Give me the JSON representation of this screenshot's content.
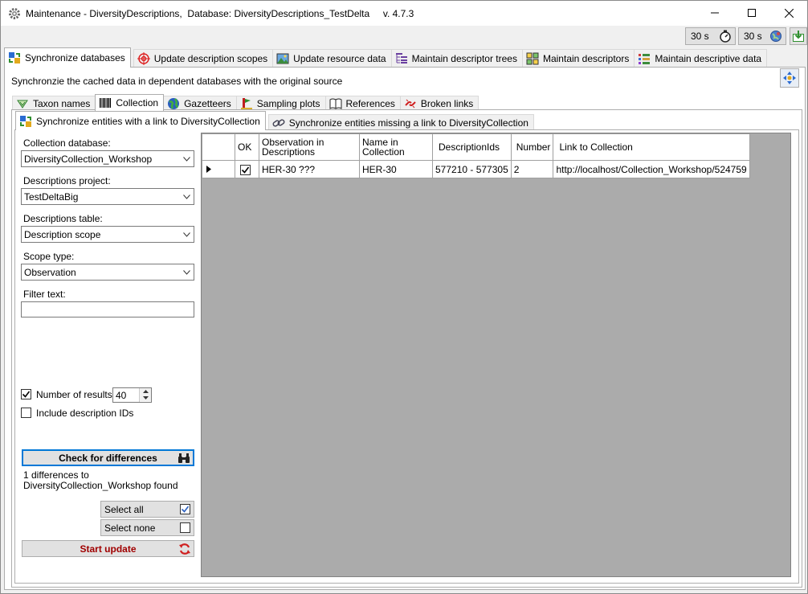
{
  "window": {
    "title": "Maintenance - DiversityDescriptions,  Database: DiversityDescriptions_TestDelta     v. 4.7.3"
  },
  "toolbar": {
    "timer1": "30 s",
    "timer2": "30 s"
  },
  "main_tabs": [
    {
      "label": "Synchronize databases",
      "icon": "sync-databases-icon",
      "active": true
    },
    {
      "label": "Update description scopes",
      "icon": "target-icon",
      "active": false
    },
    {
      "label": "Update resource data",
      "icon": "image-icon",
      "active": false
    },
    {
      "label": "Maintain descriptor trees",
      "icon": "tree-icon",
      "active": false
    },
    {
      "label": "Maintain descriptors",
      "icon": "descriptor-icon",
      "active": false
    },
    {
      "label": "Maintain descriptive data",
      "icon": "data-grid-icon",
      "active": false
    }
  ],
  "description": "Synchronzie the cached data in dependent databases with the original source",
  "sub_tabs": [
    {
      "label": "Taxon names",
      "icon": "taxon-icon",
      "active": false
    },
    {
      "label": "Collection",
      "icon": "barcode-icon",
      "active": true
    },
    {
      "label": "Gazetteers",
      "icon": "globe-icon",
      "active": false
    },
    {
      "label": "Sampling plots",
      "icon": "plot-icon",
      "active": false
    },
    {
      "label": "References",
      "icon": "book-icon",
      "active": false
    },
    {
      "label": "Broken links",
      "icon": "broken-link-icon",
      "active": false
    }
  ],
  "sync_tabs": [
    {
      "label": "Synchronize entities with a link to DiversityCollection",
      "active": true
    },
    {
      "label": "Synchronize entities missing a link to DiversityCollection",
      "active": false
    }
  ],
  "form": {
    "collection_db_label": "Collection database:",
    "collection_db_value": "DiversityCollection_Workshop",
    "project_label": "Descriptions project:",
    "project_value": "TestDeltaBig",
    "table_label": "Descriptions table:",
    "table_value": "Description scope",
    "scope_label": "Scope type:",
    "scope_value": "Observation",
    "filter_label": "Filter text:",
    "filter_value": "",
    "num_results_label": "Number of results:",
    "num_results_checked": true,
    "num_results_value": "40",
    "include_ids_label": "Include description IDs",
    "include_ids_checked": false
  },
  "actions": {
    "check_label": "Check for differences",
    "found_line1": "1 differences to",
    "found_line2": "DiversityCollection_Workshop found",
    "select_all": "Select all",
    "select_none": "Select none",
    "start_update": "Start update"
  },
  "grid": {
    "headers": {
      "ok": "OK",
      "observation": "Observation in Descriptions",
      "name": "Name in Collection",
      "ids": "DescriptionIds",
      "number": "Number",
      "link": "Link to Collection"
    },
    "rows": [
      {
        "ok": true,
        "observation": "HER-30 ???",
        "name": "HER-30",
        "ids": "577210 - 577305",
        "number": "2",
        "link": "http://localhost/Collection_Workshop/524759"
      }
    ]
  }
}
